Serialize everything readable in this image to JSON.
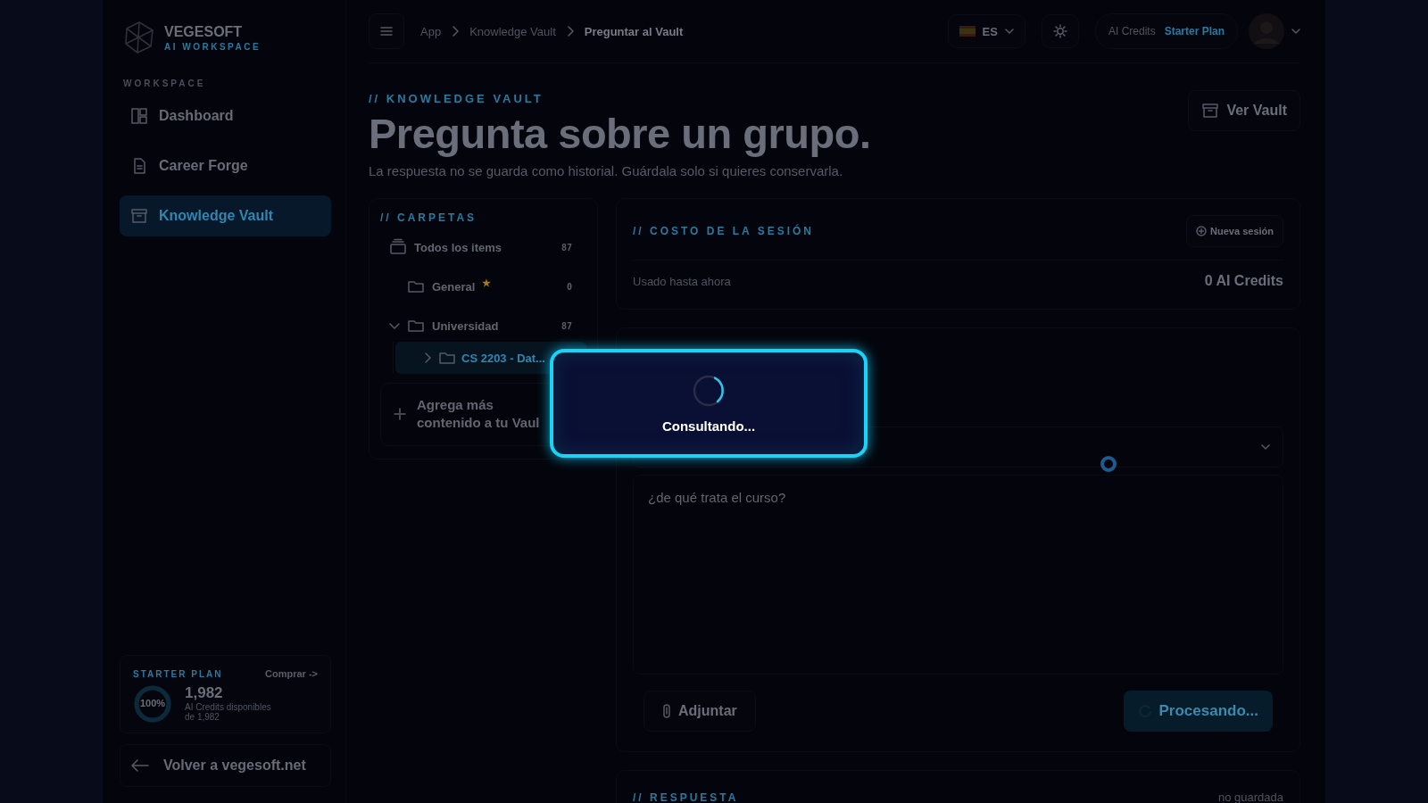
{
  "brand": {
    "name": "VEGESOFT",
    "tagline": "AI WORKSPACE"
  },
  "sidebar": {
    "section": "WORKSPACE",
    "items": [
      {
        "label": "Dashboard",
        "selected": false
      },
      {
        "label": "Career Forge",
        "selected": false
      },
      {
        "label": "Knowledge Vault",
        "selected": true
      }
    ],
    "plan": {
      "title": "STARTER PLAN",
      "action": "Comprar ->",
      "percent": "100%",
      "level": 1,
      "credits": "1,982",
      "caption": "AI Credits disponibles",
      "total": "de 1,982"
    },
    "back_link": "Volver a vegesoft.net"
  },
  "topbar": {
    "breadcrumbs": [
      {
        "label": "App",
        "current": false
      },
      {
        "label": "Knowledge Vault",
        "current": false
      },
      {
        "label": "Preguntar al Vault",
        "current": true
      }
    ],
    "language": "ES",
    "credits_label": "AI Credits",
    "plan": "Starter Plan"
  },
  "header": {
    "eyebrow": "// KNOWLEDGE VAULT",
    "title": "Pregunta sobre un grupo.",
    "subtitle": "La respuesta no se guarda como historial. Guárdala solo si quieres conservarla.",
    "button": "Ver Vault"
  },
  "folders": {
    "title": "// CARPETAS",
    "items": [
      {
        "kind": "all",
        "label": "Todos los items",
        "count": "87",
        "selected": false,
        "children": [
          {
            "kind": "folder",
            "label": "General",
            "count": "0",
            "star": "★",
            "selected": false
          },
          {
            "kind": "folder",
            "label": "Universidad",
            "count": "87",
            "expanded": true,
            "selected": false,
            "children": [
              {
                "kind": "folder",
                "label": "CS 2203 - Dat...",
                "expanded": false,
                "selected": true
              }
            ]
          }
        ]
      }
    ],
    "add_card": "Agrega más contenido a tu Vaul"
  },
  "session": {
    "title": "// COSTO DE LA SESIÓN",
    "button": "Nueva sesión",
    "label": "Usado hasta ahora",
    "value": "0 AI Credits"
  },
  "query": {
    "question": "¿de qué trata el curso?",
    "attach": "Adjuntar",
    "submit": "Procesando...",
    "loading": true
  },
  "answer": {
    "title": "// RESPUESTA",
    "status": "no guardada"
  },
  "modal": {
    "message": "Consultando..."
  }
}
